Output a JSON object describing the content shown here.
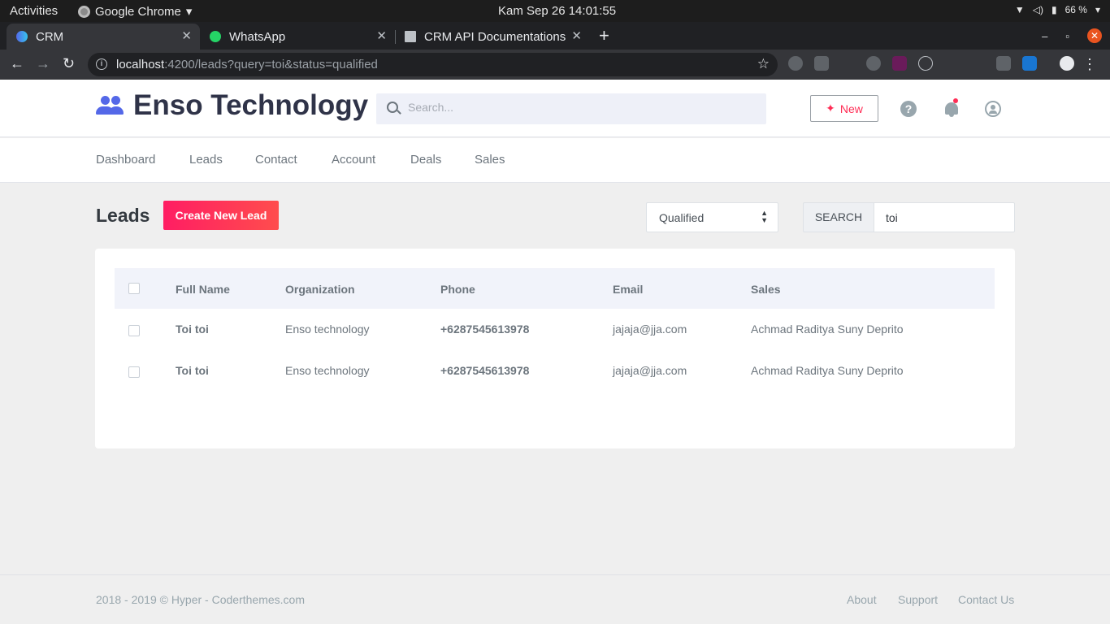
{
  "system": {
    "activities": "Activities",
    "app_name": "Google Chrome",
    "clock": "Kam Sep 26  14:01:55",
    "battery": "66 %"
  },
  "browser": {
    "tabs": [
      {
        "title": "CRM",
        "active": true
      },
      {
        "title": "WhatsApp",
        "active": false
      },
      {
        "title": "CRM API Documentations",
        "active": false
      }
    ],
    "new_tab": "+",
    "url_host": "localhost",
    "url_rest": ":4200/leads?query=toi&status=qualified"
  },
  "header": {
    "brand": "Enso Technology",
    "search_placeholder": "Search...",
    "new_button": "New",
    "help_glyph": "?"
  },
  "nav": {
    "items": [
      "Dashboard",
      "Leads",
      "Contact",
      "Account",
      "Deals",
      "Sales"
    ]
  },
  "leads": {
    "title": "Leads",
    "create_button": "Create New Lead",
    "status_filter": "Qualified",
    "search_label": "SEARCH",
    "search_value": "toi"
  },
  "table": {
    "columns": [
      "Full Name",
      "Organization",
      "Phone",
      "Email",
      "Sales"
    ],
    "rows": [
      {
        "name": "Toi toi",
        "organization": "Enso technology",
        "phone": "+6287545613978",
        "email": "jajaja@jja.com",
        "sales": "Achmad Raditya Suny Deprito"
      },
      {
        "name": "Toi toi",
        "organization": "Enso technology",
        "phone": "+6287545613978",
        "email": "jajaja@jja.com",
        "sales": "Achmad Raditya Suny Deprito"
      }
    ]
  },
  "footer": {
    "copyright": "2018 - 2019 © Hyper - Coderthemes.com",
    "links": [
      "About",
      "Support",
      "Contact Us"
    ]
  },
  "colors": {
    "accent": "#ff2d55",
    "brand_icon": "#5468e8",
    "table_header_bg": "#f1f3fa"
  }
}
